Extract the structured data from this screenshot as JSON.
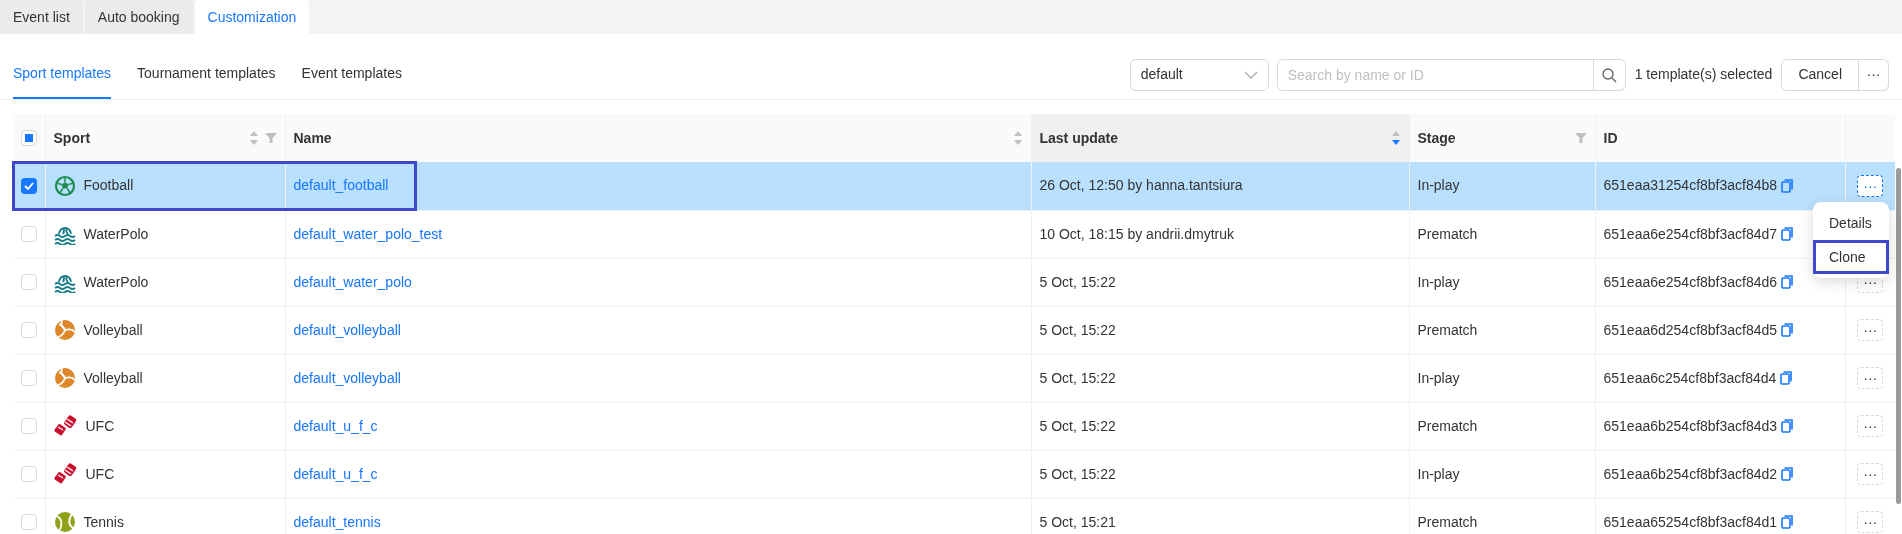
{
  "tabs": [
    {
      "label": "Event list",
      "selected": false
    },
    {
      "label": "Auto booking",
      "selected": false
    },
    {
      "label": "Customization",
      "selected": true
    }
  ],
  "subtabs": [
    {
      "label": "Sport templates",
      "selected": true
    },
    {
      "label": "Tournament templates",
      "selected": false
    },
    {
      "label": "Event templates",
      "selected": false
    }
  ],
  "toolbar": {
    "select_value": "default",
    "search": {
      "placeholder": "Search by name or ID"
    },
    "selection_text": "1 template(s) selected",
    "cancel_button": "Cancel",
    "more_button": "···"
  },
  "table": {
    "select_all_partial": true,
    "columns": [
      {
        "label": "Sport",
        "sortable": true,
        "sorted_descending": false,
        "filterable": true
      },
      {
        "label": "Name",
        "sortable": true,
        "sorted_descending": false,
        "filterable": false
      },
      {
        "label": "Last update",
        "sortable": true,
        "sorted_descending": true,
        "filterable": false
      },
      {
        "label": "Stage",
        "sortable": false,
        "filterable": true
      },
      {
        "label": "ID",
        "sortable": false,
        "filterable": false
      }
    ],
    "rows": [
      {
        "checked": true,
        "highlighted": true,
        "kind": "football",
        "sport": "Football",
        "name": "default_football",
        "last_update": "26 Oct, 12:50 by hanna.tantsiura",
        "stage": "In-play",
        "id": "651eaa31254cf8bf3acf84b8",
        "actions": "···",
        "actions_open": true
      },
      {
        "checked": false,
        "highlighted": false,
        "kind": "waterpolo",
        "sport": "WaterPolo",
        "name": "default_water_polo_test",
        "last_update": "10 Oct, 18:15 by andrii.dmytruk",
        "stage": "Prematch",
        "id": "651eaa6e254cf8bf3acf84d7"
      },
      {
        "checked": false,
        "highlighted": false,
        "kind": "waterpolo",
        "sport": "WaterPolo",
        "name": "default_water_polo",
        "last_update": "5 Oct, 15:22",
        "stage": "In-play",
        "id": "651eaa6e254cf8bf3acf84d6",
        "actions": "···",
        "actions_open": false
      },
      {
        "checked": false,
        "highlighted": false,
        "kind": "volleyball",
        "sport": "Volleyball",
        "name": "default_volleyball",
        "last_update": "5 Oct, 15:22",
        "stage": "Prematch",
        "id": "651eaa6d254cf8bf3acf84d5",
        "actions": "···",
        "actions_open": false
      },
      {
        "checked": false,
        "highlighted": false,
        "kind": "volleyball",
        "sport": "Volleyball",
        "name": "default_volleyball",
        "last_update": "5 Oct, 15:22",
        "stage": "In-play",
        "id": "651eaa6c254cf8bf3acf84d4",
        "actions": "···",
        "actions_open": false
      },
      {
        "checked": false,
        "highlighted": false,
        "kind": "ufc",
        "sport": "UFC",
        "name": "default_u_f_c",
        "last_update": "5 Oct, 15:22",
        "stage": "Prematch",
        "id": "651eaa6b254cf8bf3acf84d3",
        "actions": "···",
        "actions_open": false
      },
      {
        "checked": false,
        "highlighted": false,
        "kind": "ufc",
        "sport": "UFC",
        "name": "default_u_f_c",
        "last_update": "5 Oct, 15:22",
        "stage": "In-play",
        "id": "651eaa6b254cf8bf3acf84d2",
        "actions": "···",
        "actions_open": false
      },
      {
        "checked": false,
        "highlighted": false,
        "kind": "tennis",
        "sport": "Tennis",
        "name": "default_tennis",
        "last_update": "5 Oct, 15:21",
        "stage": "Prematch",
        "id": "651eaa65254cf8bf3acf84d1",
        "actions": "···",
        "actions_open": false
      }
    ]
  },
  "row_menu": {
    "items": [
      {
        "label": "Details",
        "highlighted": false
      },
      {
        "label": "Clone",
        "highlighted": true
      }
    ]
  }
}
